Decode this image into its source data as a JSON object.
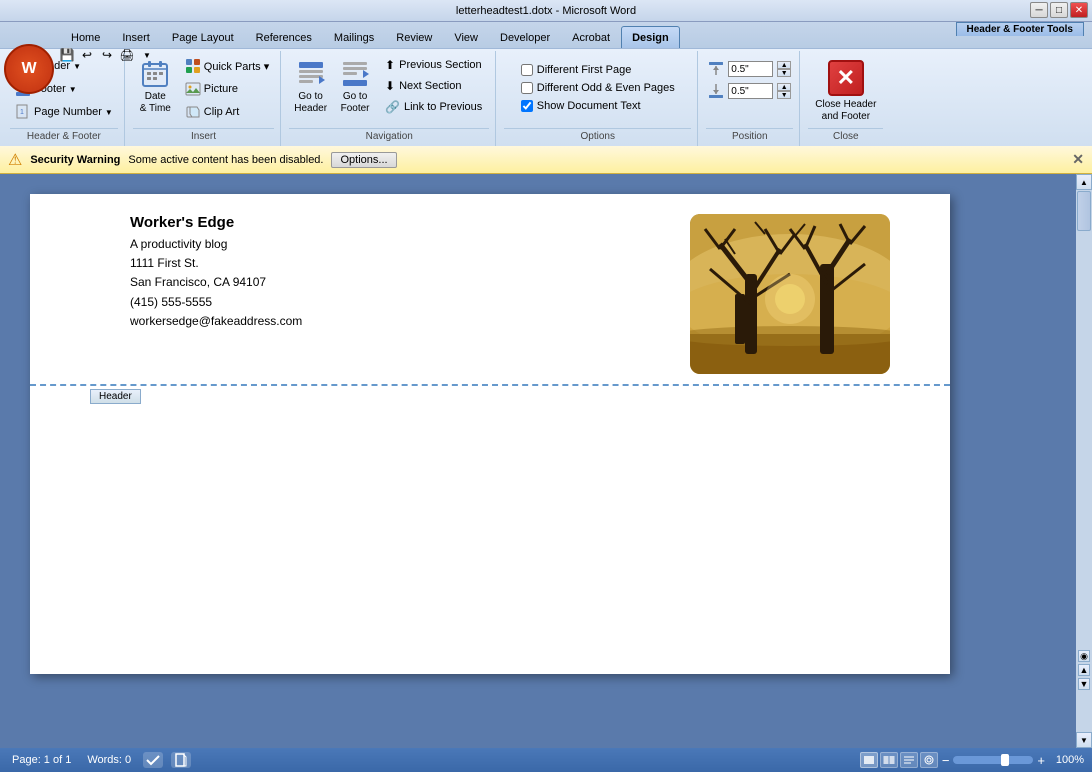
{
  "window": {
    "title": "letterheadtest1.dotx - Microsoft Word",
    "hf_tools_label": "Header & Footer Tools"
  },
  "titlebar": {
    "title": "letterheadtest1.dotx - Microsoft Word",
    "minimize": "─",
    "maximize": "□",
    "close": "✕"
  },
  "ribbon": {
    "tabs": [
      {
        "id": "home",
        "label": "Home",
        "active": false
      },
      {
        "id": "insert",
        "label": "Insert",
        "active": false
      },
      {
        "id": "page_layout",
        "label": "Page Layout",
        "active": false
      },
      {
        "id": "references",
        "label": "References",
        "active": false
      },
      {
        "id": "mailings",
        "label": "Mailings",
        "active": false
      },
      {
        "id": "review",
        "label": "Review",
        "active": false
      },
      {
        "id": "view",
        "label": "View",
        "active": false
      },
      {
        "id": "developer",
        "label": "Developer",
        "active": false
      },
      {
        "id": "acrobat",
        "label": "Acrobat",
        "active": false
      },
      {
        "id": "design",
        "label": "Design",
        "active": true
      }
    ],
    "groups": {
      "header_footer": {
        "label": "Header & Footer",
        "header_btn": "Header",
        "footer_btn": "Footer",
        "page_number_btn": "Page Number"
      },
      "insert": {
        "label": "Insert",
        "date_time_btn": "Date\n& Time",
        "quick_parts_btn": "Quick Parts ▾",
        "picture_btn": "Picture",
        "clip_art_btn": "Clip Art"
      },
      "navigation": {
        "label": "Navigation",
        "go_to_header_btn": "Go to\nHeader",
        "go_to_footer_btn": "Go to\nFooter",
        "prev_section_btn": "Previous Section",
        "next_section_btn": "Next Section",
        "link_to_prev_btn": "Link to Previous"
      },
      "options": {
        "label": "Options",
        "different_first_page": "Different First Page",
        "different_odd_even": "Different Odd & Even Pages",
        "show_doc_text": "Show Document Text",
        "show_doc_text_checked": true
      },
      "position": {
        "label": "Position",
        "header_top_label": "0.5\"",
        "footer_bottom_label": "0.5\""
      },
      "close": {
        "label": "Close",
        "close_hf_btn": "Close Header\nand Footer"
      }
    }
  },
  "security_bar": {
    "title": "Security Warning",
    "message": "Some active content has been disabled.",
    "options_btn": "Options...",
    "icon": "⚠"
  },
  "document": {
    "company_name": "Worker's Edge",
    "tagline": "A productivity blog",
    "address1": "1111 First St.",
    "address2": "San Francisco, CA 94107",
    "phone": "(415) 555-5555",
    "email": "workersedge@fakeaddress.com",
    "header_tab": "Header"
  },
  "statusbar": {
    "page_info": "Page: 1 of 1",
    "words": "Words: 0",
    "zoom": "100%",
    "zoom_minus": "−",
    "zoom_plus": "+"
  }
}
